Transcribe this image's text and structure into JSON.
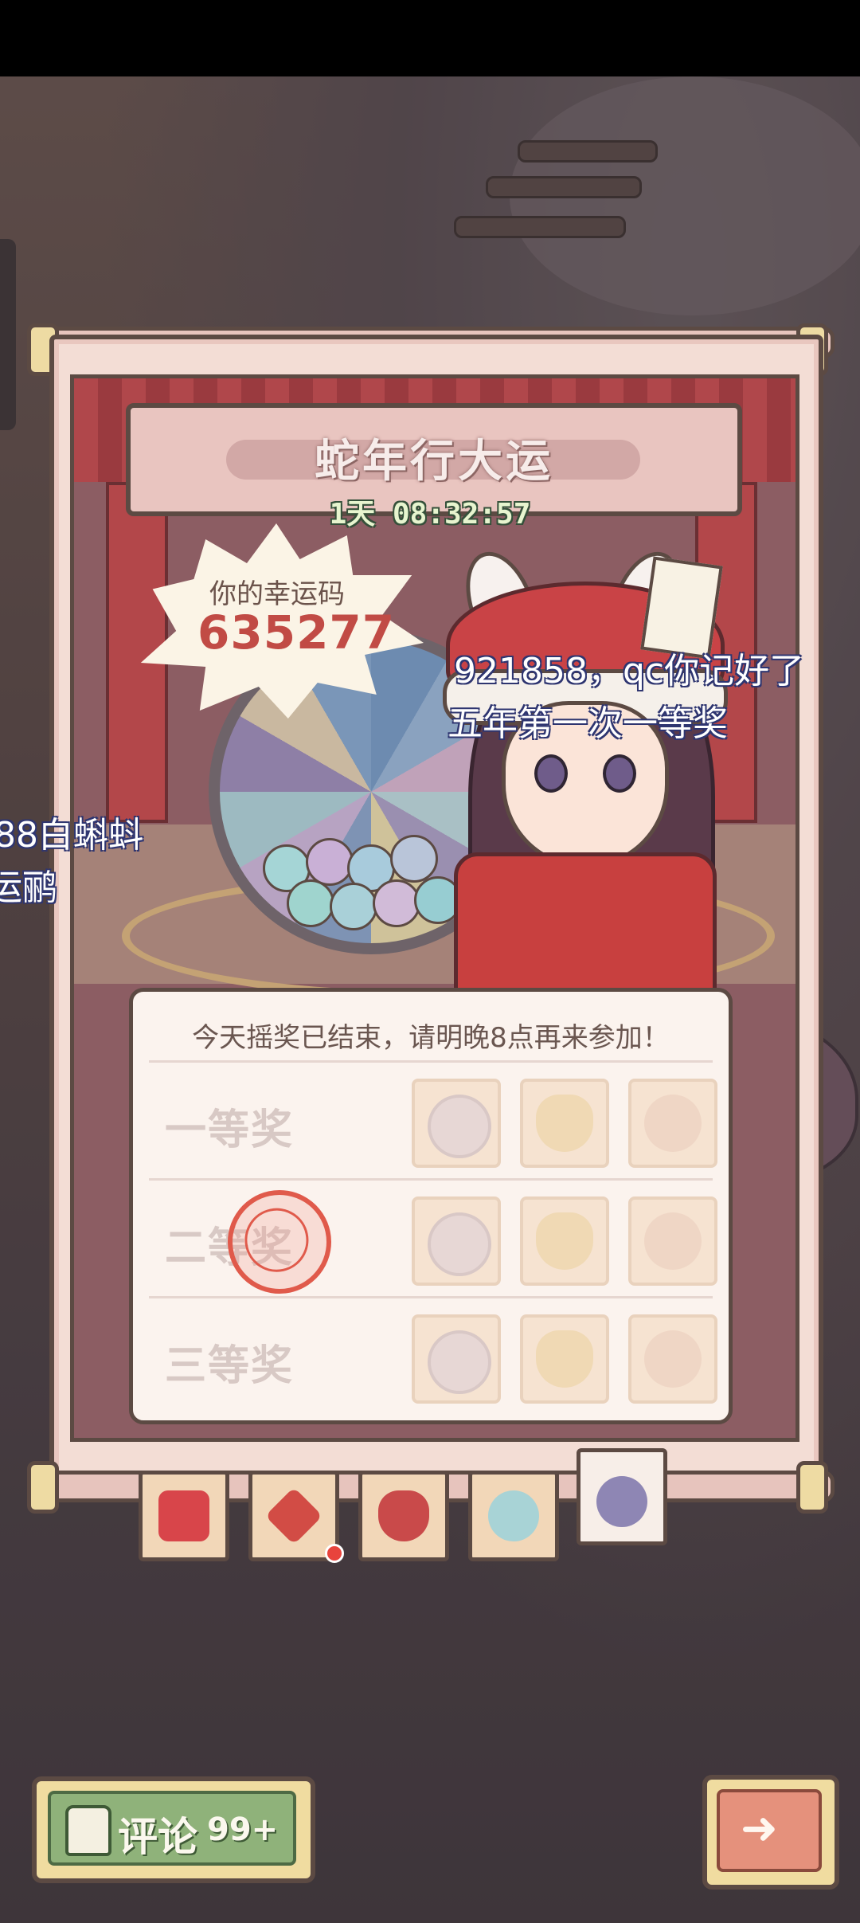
{
  "event": {
    "title": "蛇年行大运",
    "countdown": "1天 08:32:57"
  },
  "lucky_code": {
    "label": "你的幸运码",
    "code": "635277"
  },
  "danmaku": [
    "921858，qc你记好了",
    "五年第一次一等奖",
    "88白蝌蚪",
    "运鹂"
  ],
  "prizes": {
    "notice": "今天摇奖已结束，请明晚8点再来参加！",
    "rows": [
      {
        "label": "一等奖",
        "items": [
          "crystal-ball-icon",
          "dumpling-icon",
          "tadpole-icon"
        ]
      },
      {
        "label": "二等奖",
        "items": [
          "crystal-ball-icon",
          "dumpling-icon",
          "tadpole-icon"
        ]
      },
      {
        "label": "三等奖",
        "items": [
          "crystal-ball-icon",
          "dumpling-icon",
          "tadpole-icon"
        ]
      }
    ],
    "stamp": "awarded-stamp"
  },
  "tabs": [
    {
      "icon": "red-envelope-icon"
    },
    {
      "icon": "fortune-fu-icon",
      "badge": true
    },
    {
      "icon": "lucky-bag-icon"
    },
    {
      "icon": "candy-icon"
    },
    {
      "icon": "lottery-wheel-icon",
      "active": true
    }
  ],
  "bottom": {
    "comment_label": "评论",
    "comment_count": "99+",
    "next": "arrow-right-icon"
  },
  "colors": {
    "accent_red": "#c14b45",
    "timer_green": "#e7f5cf",
    "comment_green": "#8fb27a",
    "next_orange": "#e5917c"
  }
}
